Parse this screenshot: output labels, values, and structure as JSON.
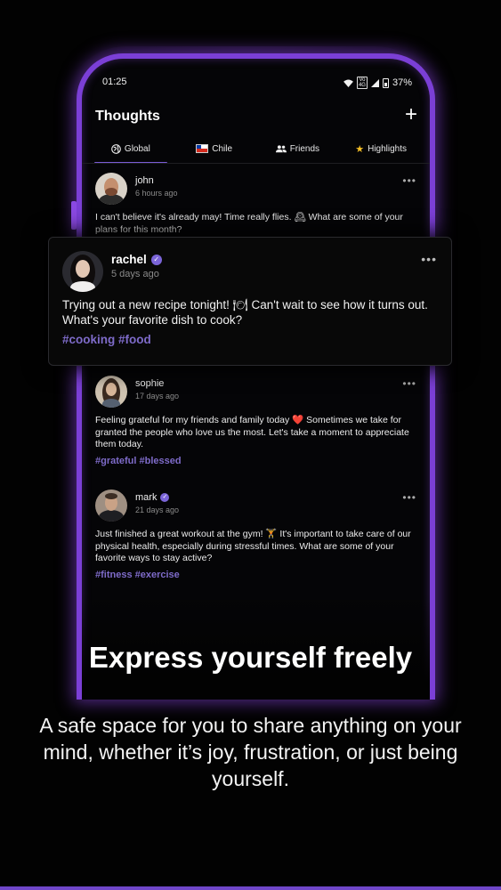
{
  "status_bar": {
    "time": "01:25",
    "battery": "37%",
    "network_label": "Vo)\n4G"
  },
  "header": {
    "title": "Thoughts",
    "add_label": "+"
  },
  "tabs": [
    {
      "label": "Global",
      "icon": "globe-icon"
    },
    {
      "label": "Chile",
      "icon": "chile-flag-icon"
    },
    {
      "label": "Friends",
      "icon": "people-icon"
    },
    {
      "label": "Highlights",
      "icon": "star-icon"
    }
  ],
  "posts": [
    {
      "name": "john",
      "time": "6 hours ago",
      "verified": false,
      "body": "I can't believe it's already may! Time really flies. 🕰 What are some of your plans for this month?",
      "tags": ""
    },
    {
      "name": "rachel",
      "time": "5 days ago",
      "verified": true,
      "body": "Trying out a new recipe tonight! 🍽 Can't wait to see how it turns out. What's your favorite dish to cook?",
      "tags": "#cooking #food"
    },
    {
      "name": "sophie",
      "time": "17 days ago",
      "verified": false,
      "body": "Feeling grateful for my friends and family today ❤️ Sometimes we take for granted the people who love us the most. Let's take a moment to appreciate them today.",
      "tags": "#grateful #blessed"
    },
    {
      "name": "mark",
      "time": "21 days ago",
      "verified": true,
      "body": "Just finished a great workout at the gym! 🏋 It's important to take care of our physical health, especially during stressful times. What are some of your favorite ways to stay active?",
      "tags": "#fitness #exercise"
    }
  ],
  "more_label": "•••",
  "promo": {
    "headline": "Express yourself freely",
    "subtext": "A safe space for you to share anything on your mind, whether it’s joy, frustration, or just being yourself."
  },
  "colors": {
    "accent": "#7b5cd6",
    "frame": "#7b3fd6",
    "tag": "#7e6bc9",
    "background": "#020202"
  }
}
